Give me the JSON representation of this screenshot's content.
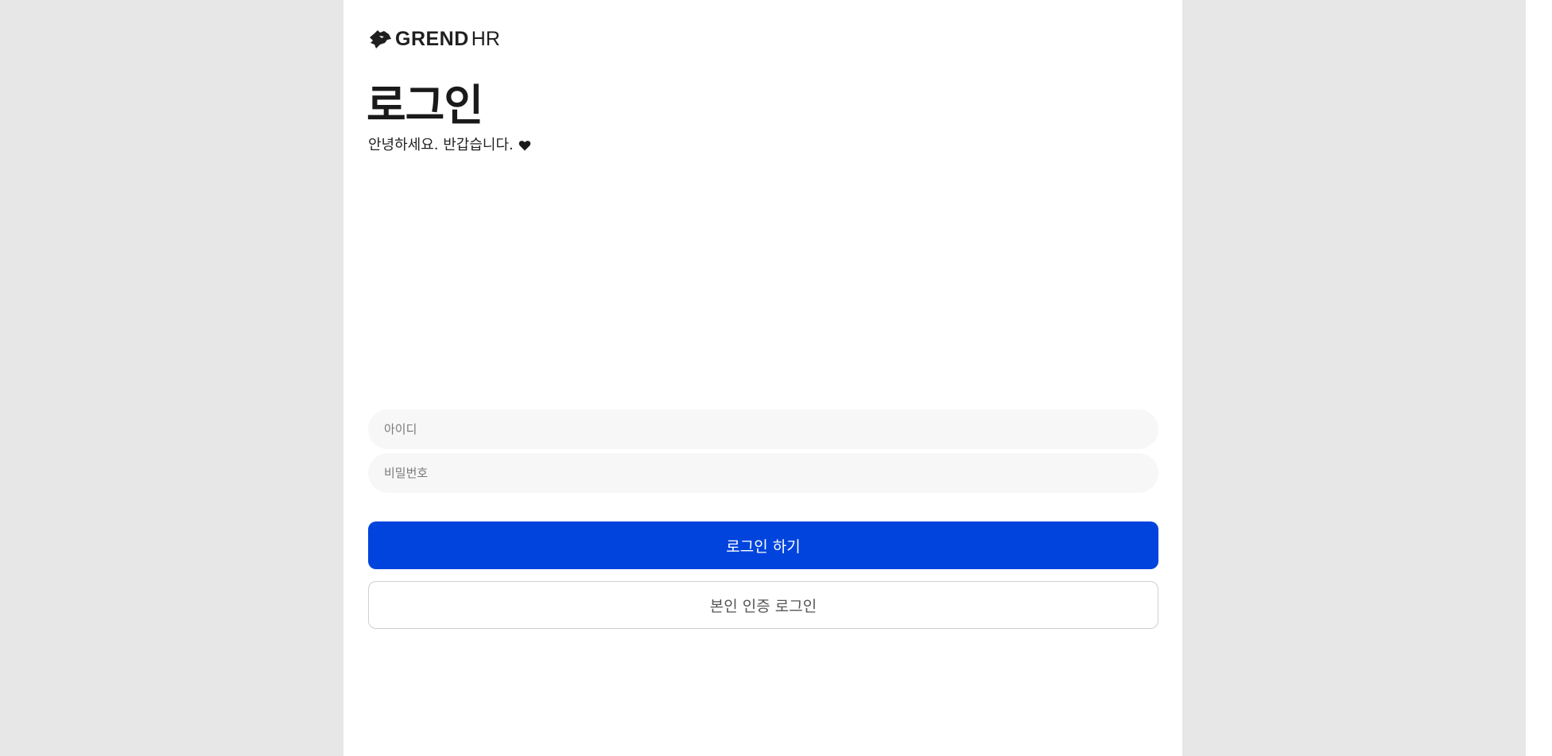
{
  "brand": {
    "name_strong": "GREND",
    "name_light": "HR",
    "logo_icon": "panther-head-icon",
    "color": "#1f1f1f"
  },
  "login": {
    "title": "로그인",
    "greeting": "안녕하세요. 반갑습니다.",
    "greeting_icon": "heart-icon",
    "id_field": {
      "placeholder": "아이디",
      "value": ""
    },
    "password_field": {
      "placeholder": "비밀번호",
      "value": ""
    },
    "submit_label": "로그인 하기",
    "verify_login_label": "본인 인증 로그인"
  },
  "colors": {
    "background": "#e7e7e7",
    "panel": "#ffffff",
    "primary": "#0044dd",
    "input_bg": "#f7f7f7"
  }
}
